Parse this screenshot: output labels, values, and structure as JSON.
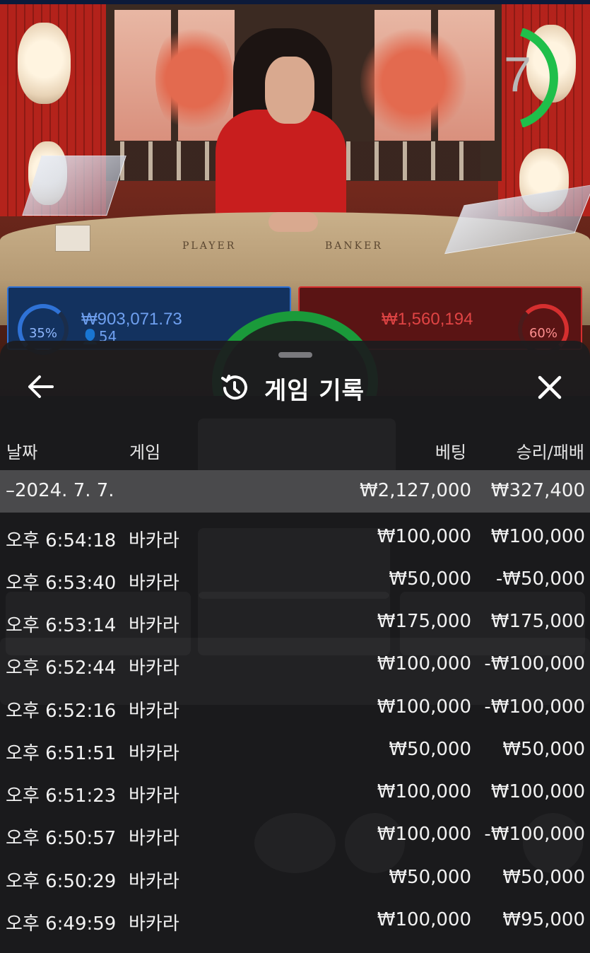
{
  "background": {
    "table_labels": [
      "PLAYER",
      "BANKER"
    ],
    "timer": "7",
    "player": {
      "percent": "35%",
      "amount": "₩903,071.73",
      "count": "54"
    },
    "banker": {
      "percent": "60%",
      "amount": "₩1,560,194"
    }
  },
  "sheet": {
    "title": "게임 기록",
    "back_icon": "arrow-left-icon",
    "close_icon": "close-icon",
    "history_icon": "history-clock-icon",
    "columns": {
      "date": "날짜",
      "game": "게임",
      "bet": "베팅",
      "win_loss": "승리/패배"
    },
    "date_group": {
      "label": "–2024. 7. 7.",
      "bet": "₩2,127,000",
      "win_loss": "₩327,400"
    },
    "rows": [
      {
        "time": "오후 6:54:18",
        "game": "바카라",
        "bet": "₩100,000",
        "win_loss": "₩100,000"
      },
      {
        "time": "오후 6:53:40",
        "game": "바카라",
        "bet": "₩50,000",
        "win_loss": "-₩50,000"
      },
      {
        "time": "오후 6:53:14",
        "game": "바카라",
        "bet": "₩175,000",
        "win_loss": "₩175,000"
      },
      {
        "time": "오후 6:52:44",
        "game": "바카라",
        "bet": "₩100,000",
        "win_loss": "-₩100,000"
      },
      {
        "time": "오후 6:52:16",
        "game": "바카라",
        "bet": "₩100,000",
        "win_loss": "-₩100,000"
      },
      {
        "time": "오후 6:51:51",
        "game": "바카라",
        "bet": "₩50,000",
        "win_loss": "₩50,000"
      },
      {
        "time": "오후 6:51:23",
        "game": "바카라",
        "bet": "₩100,000",
        "win_loss": "₩100,000"
      },
      {
        "time": "오후 6:50:57",
        "game": "바카라",
        "bet": "₩100,000",
        "win_loss": "-₩100,000"
      },
      {
        "time": "오후 6:50:29",
        "game": "바카라",
        "bet": "₩50,000",
        "win_loss": "₩50,000"
      },
      {
        "time": "오후 6:49:59",
        "game": "바카라",
        "bet": "₩100,000",
        "win_loss": "₩95,000"
      }
    ]
  },
  "colors": {
    "player_blue": "#2f72d6",
    "banker_red": "#d62f2f",
    "timer_green": "#1fbf4a",
    "sheet_bg": "#1c1c1e",
    "date_row_bg": "#4a4a4c"
  }
}
